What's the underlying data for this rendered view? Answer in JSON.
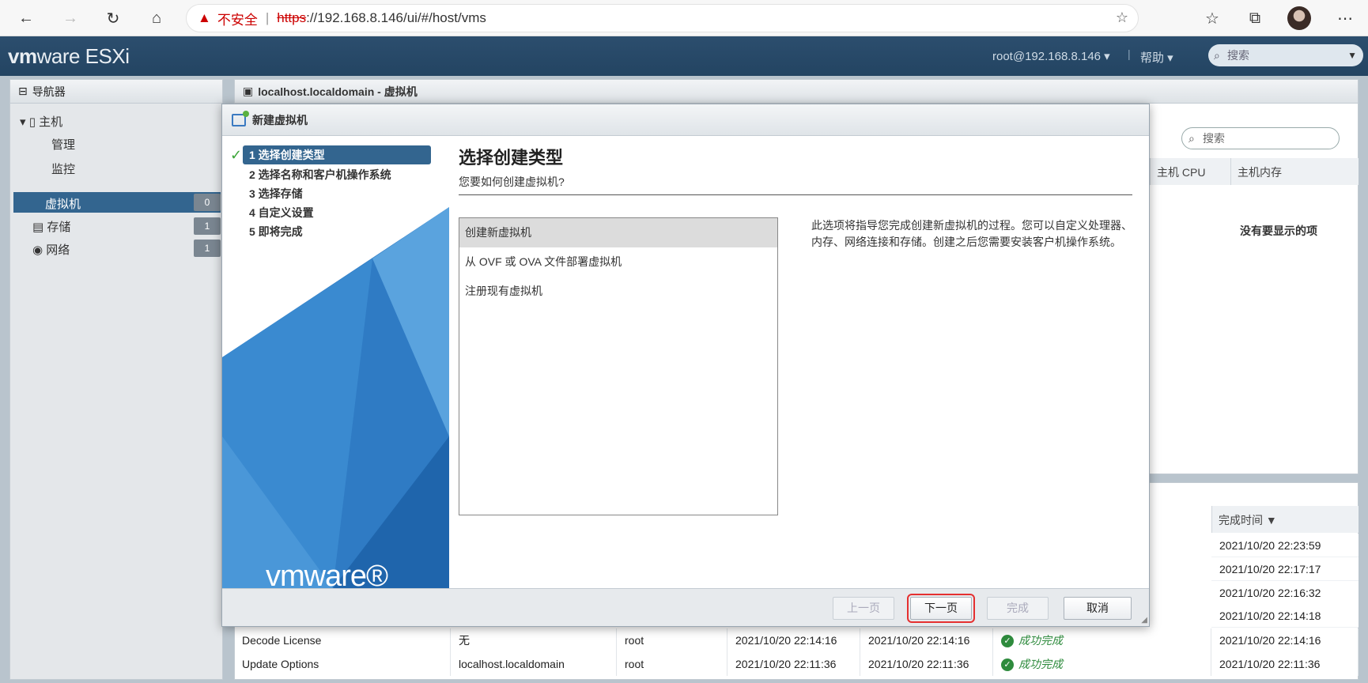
{
  "browser": {
    "warning": "不安全",
    "url_scheme": "https",
    "url_rest": "://192.168.8.146/ui/#/host/vms"
  },
  "header": {
    "logo_a": "vm",
    "logo_b": "ware",
    "logo_product": "ESXi",
    "user": "root@192.168.8.146 ▾",
    "help": "帮助 ▾",
    "search_placeholder": "搜索"
  },
  "navigator": {
    "title": "导航器",
    "host": "主机",
    "manage": "管理",
    "monitor": "监控",
    "vms": "虚拟机",
    "vms_count": "0",
    "storage": "存储",
    "storage_count": "1",
    "network": "网络",
    "network_count": "1"
  },
  "main": {
    "title": "localhost.localdomain - 虚拟机",
    "search_placeholder": "搜索",
    "col_cpu": "主机 CPU",
    "col_mem": "主机内存",
    "empty_note": "没有要显示的项"
  },
  "tasks": {
    "col_complete": "完成时间 ▼",
    "times": [
      "2021/10/20 22:23:59",
      "2021/10/20 22:17:17",
      "2021/10/20 22:16:32",
      "2021/10/20 22:14:18"
    ],
    "rows": [
      {
        "task": "Decode License",
        "target": "无",
        "initiator": "root",
        "queued": "2021/10/20 22:14:16",
        "started": "2021/10/20 22:14:16",
        "result": "成功完成",
        "completed": "2021/10/20 22:14:16"
      },
      {
        "task": "Update Options",
        "target": "localhost.localdomain",
        "initiator": "root",
        "queued": "2021/10/20 22:11:36",
        "started": "2021/10/20 22:11:36",
        "result": "成功完成",
        "completed": "2021/10/20 22:11:36"
      }
    ]
  },
  "dialog": {
    "title": "新建虚拟机",
    "steps": [
      "1 选择创建类型",
      "2 选择名称和客户机操作系统",
      "3 选择存储",
      "4 自定义设置",
      "5 即将完成"
    ],
    "logo": "vmware®",
    "heading": "选择创建类型",
    "subheading": "您要如何创建虚拟机?",
    "options": [
      "创建新虚拟机",
      "从 OVF 或 OVA 文件部署虚拟机",
      "注册现有虚拟机"
    ],
    "description": "此选项将指导您完成创建新虚拟机的过程。您可以自定义处理器、内存、网络连接和存储。创建之后您需要安装客户机操作系统。",
    "btn_prev": "上一页",
    "btn_next": "下一页",
    "btn_finish": "完成",
    "btn_cancel": "取消"
  }
}
